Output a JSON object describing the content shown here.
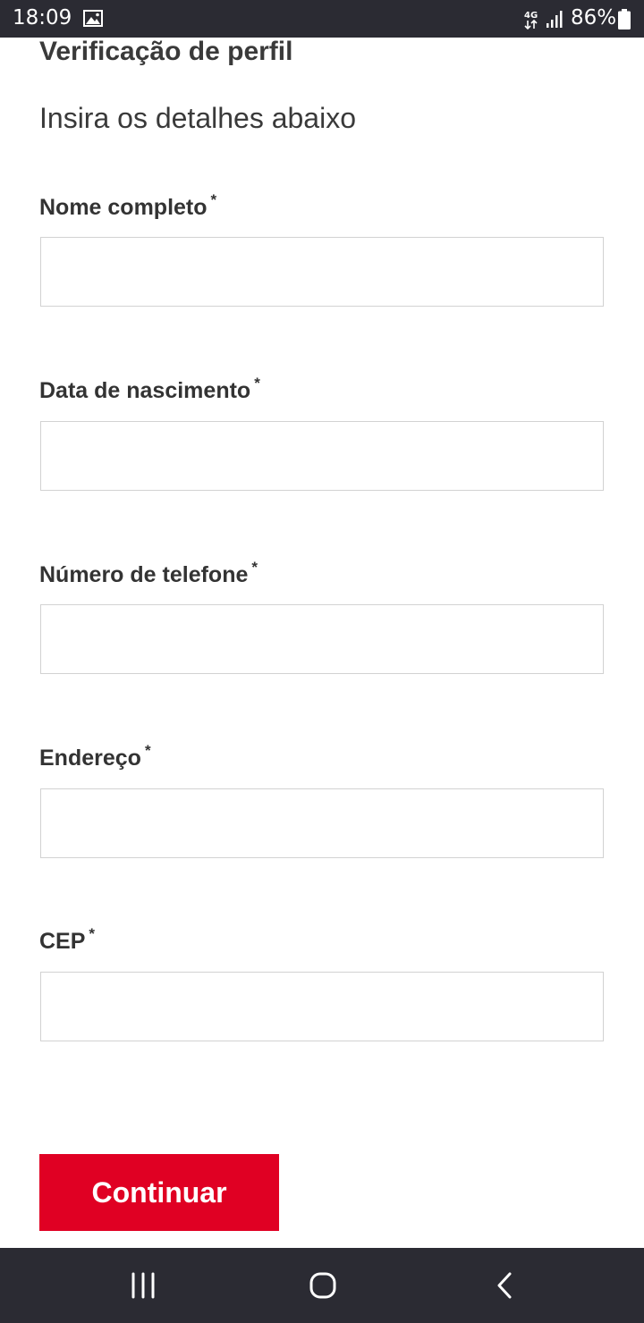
{
  "status_bar": {
    "time": "18:09",
    "network": "4G",
    "battery": "86%",
    "icons": [
      "gallery-icon",
      "network-4g-icon",
      "signal-icon",
      "battery-icon"
    ]
  },
  "page": {
    "title": "Verificação de perfil",
    "subtitle": "Insira os detalhes abaixo"
  },
  "form": {
    "required_marker": "*",
    "fields": [
      {
        "label": "Nome completo",
        "value": ""
      },
      {
        "label": "Data de nascimento",
        "value": ""
      },
      {
        "label": "Número de telefone",
        "value": ""
      },
      {
        "label": "Endereço",
        "value": ""
      },
      {
        "label": "CEP",
        "value": ""
      }
    ],
    "submit_label": "Continuar"
  },
  "nav_bar": {
    "buttons": [
      "recent-apps-icon",
      "home-icon",
      "back-icon"
    ]
  },
  "colors": {
    "accent": "#e00023",
    "system_bar": "#2b2b33",
    "input_border": "#d2d2d2",
    "text": "#333333"
  }
}
